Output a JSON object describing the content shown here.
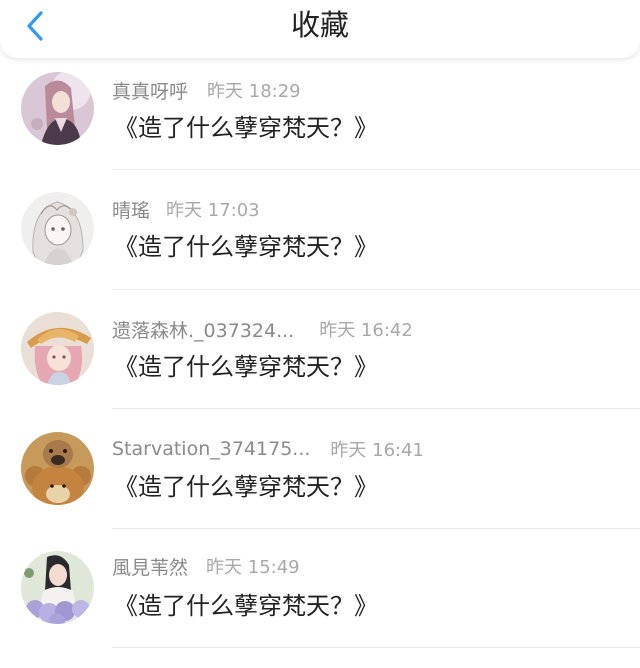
{
  "header": {
    "title": "收藏",
    "back_icon": "chevron-left-icon",
    "accent_color": "#2e9bf0"
  },
  "items": [
    {
      "username": "真真呀呼",
      "time": "昨天 18:29",
      "message": "《造了什么孽穿梵天？》",
      "avatar": "anime-girl-avatar"
    },
    {
      "username": "晴瑤",
      "time": "昨天 17:03",
      "message": "《造了什么孽穿梵天？》",
      "avatar": "sketch-girl-avatar"
    },
    {
      "username": "遗落森林._037324...",
      "time": "昨天 16:42",
      "message": "《造了什么孽穿梵天？》",
      "avatar": "hat-girl-avatar"
    },
    {
      "username": "Starvation_374175...",
      "time": "昨天 16:41",
      "message": "《造了什么孽穿梵天？》",
      "avatar": "dog-bear-avatar"
    },
    {
      "username": "風見苇然",
      "time": "昨天 15:49",
      "message": "《造了什么孽穿梵天？》",
      "avatar": "flower-girl-avatar"
    }
  ]
}
